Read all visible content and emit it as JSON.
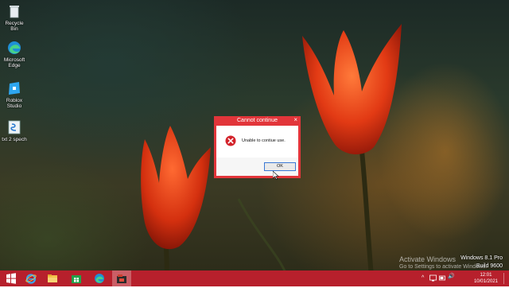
{
  "desktop_icons": [
    {
      "label": "Recycle Bin",
      "icon": "recycle-bin-icon"
    },
    {
      "label": "Microsoft Edge",
      "icon": "edge-icon"
    },
    {
      "label": "Roblox Studio",
      "icon": "roblox-studio-icon"
    },
    {
      "label": "txt 2 spech",
      "icon": "text-to-speech-icon"
    }
  ],
  "dialog": {
    "title": "Cannot continue",
    "close_glyph": "×",
    "message": "Unable to contiue use.",
    "ok_label": "OK",
    "accent": "#e2353a",
    "icon": "error-icon"
  },
  "watermark": {
    "title": "Activate Windows",
    "subtitle": "Go to Settings to activate Windows."
  },
  "os_build": {
    "line1": "Windows 8.1 Pro",
    "line2": "Build 9600"
  },
  "taskbar": {
    "color": "#b7202c",
    "apps": [
      "windows-start-icon",
      "internet-explorer-icon",
      "file-explorer-icon",
      "store-icon",
      "edge-icon",
      "app-icon"
    ],
    "tray_glyphs": {
      "arrow": "^",
      "speaker": "🔊"
    },
    "clock_time": "12:01",
    "clock_date": "10/01/2021"
  }
}
